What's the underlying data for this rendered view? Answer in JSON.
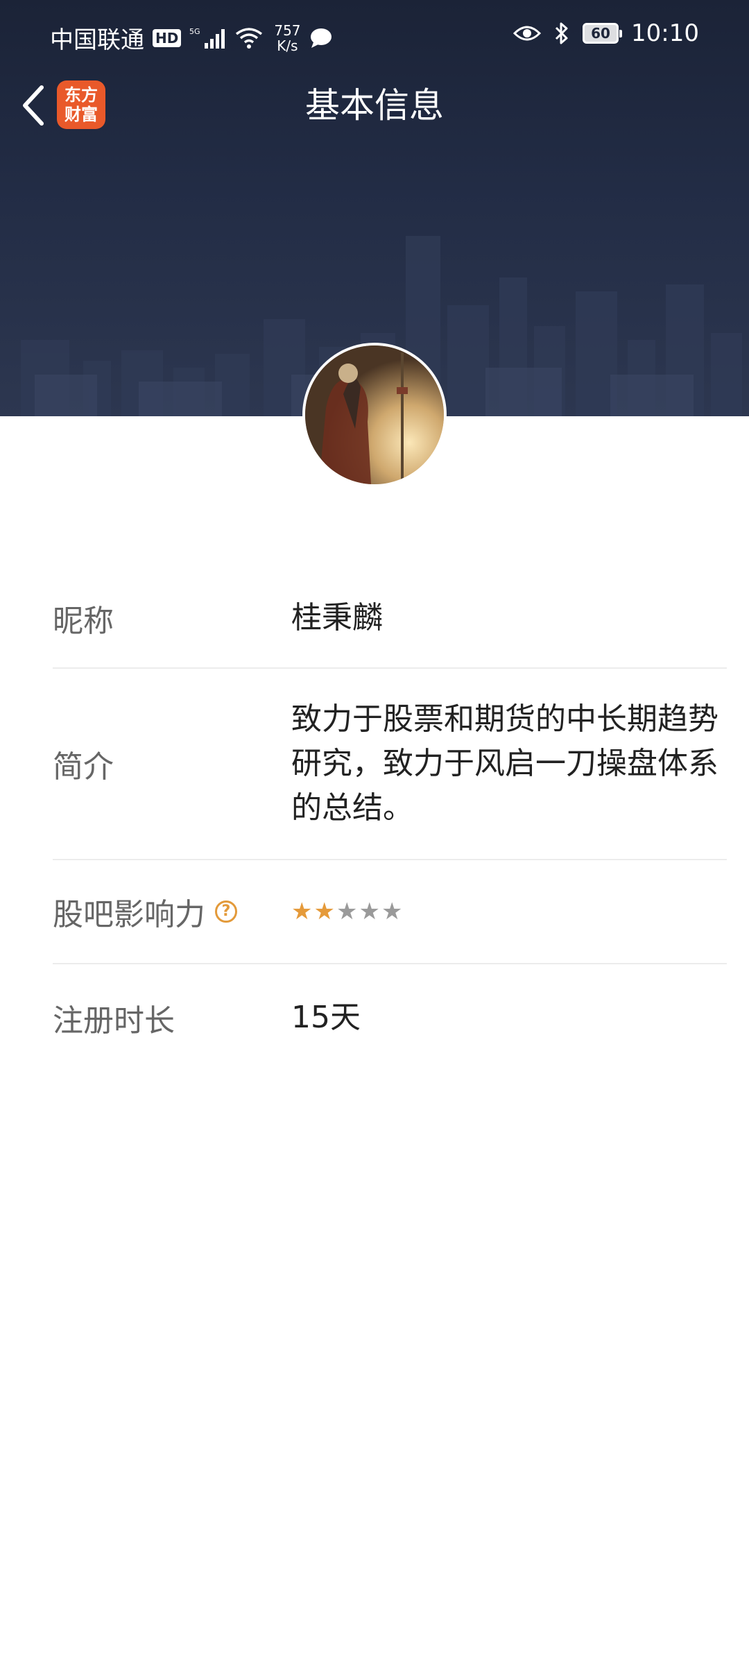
{
  "status_bar": {
    "carrier": "中国联通",
    "hd": "HD",
    "net_speed_value": "757",
    "net_speed_unit": "K/s",
    "battery": "60",
    "time": "10:10"
  },
  "nav": {
    "title": "基本信息",
    "app_logo_line1": "东方",
    "app_logo_line2": "财富"
  },
  "profile": {
    "nickname_label": "昵称",
    "nickname_value": "桂秉麟",
    "bio_label": "简介",
    "bio_value": "致力于股票和期货的中长期趋势研究，致力于风启一刀操盘体系的总结。",
    "influence_label": "股吧影响力",
    "influence_stars": 2,
    "influence_max": 5,
    "registration_label": "注册时长",
    "registration_value": "15天"
  },
  "colors": {
    "banner": "#1b2337",
    "accent_star": "#e59a3a",
    "logo": "#e9592a"
  }
}
